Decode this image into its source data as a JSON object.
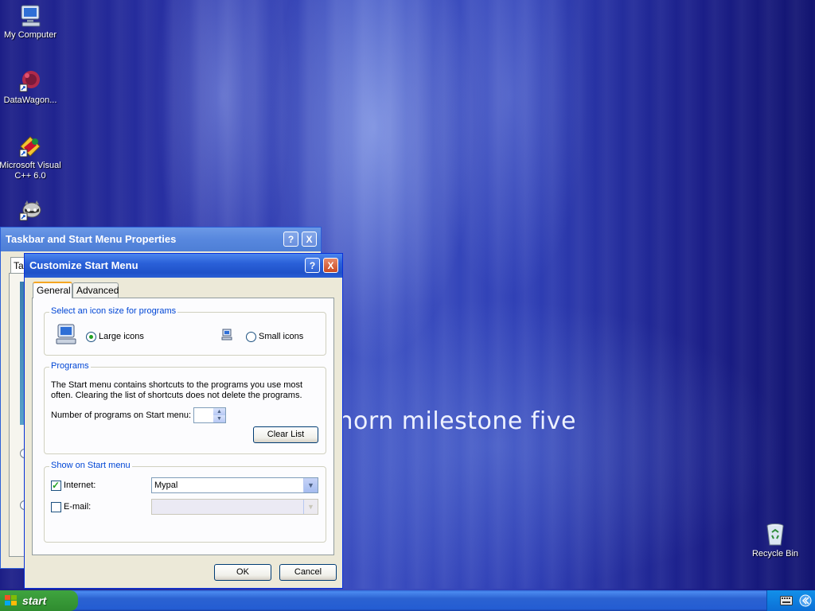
{
  "desktop": {
    "icons": [
      {
        "label": "My Computer",
        "icon": "computer-icon"
      },
      {
        "label": "DataWagon...",
        "icon": "datawagon-icon"
      },
      {
        "label": "Microsoft Visual C++ 6.0",
        "icon": "visual-cpp-icon"
      },
      {
        "label": "",
        "icon": "raccoon-icon"
      },
      {
        "label": "Recycle Bin",
        "icon": "recycle-bin-icon"
      }
    ],
    "wallpaper_text": "ghorn milestone five"
  },
  "back_window": {
    "title": "Taskbar and Start Menu Properties",
    "help_button": "?",
    "close_button": "X",
    "tab_partial": "Ta"
  },
  "dialog": {
    "title": "Customize Start Menu",
    "help_button": "?",
    "close_button": "X",
    "tabs": [
      {
        "label": "General",
        "active": true
      },
      {
        "label": "Advanced",
        "active": false
      }
    ],
    "icon_size": {
      "title": "Select an icon size for programs",
      "large_label": "Large icons",
      "small_label": "Small icons",
      "selected": "large"
    },
    "programs": {
      "title": "Programs",
      "description": "The Start menu contains shortcuts to the programs you use most often. Clearing the list of shortcuts does not delete the programs.",
      "count_label": "Number of programs on Start menu:",
      "count_value": "",
      "clear_button": "Clear List"
    },
    "show_on_start": {
      "title": "Show on Start menu",
      "internet_label": "Internet:",
      "internet_checked": true,
      "internet_value": "Mypal",
      "email_label": "E-mail:",
      "email_checked": false,
      "email_value": ""
    },
    "ok_button": "OK",
    "cancel_button": "Cancel"
  },
  "taskbar": {
    "start_label": "start"
  }
}
